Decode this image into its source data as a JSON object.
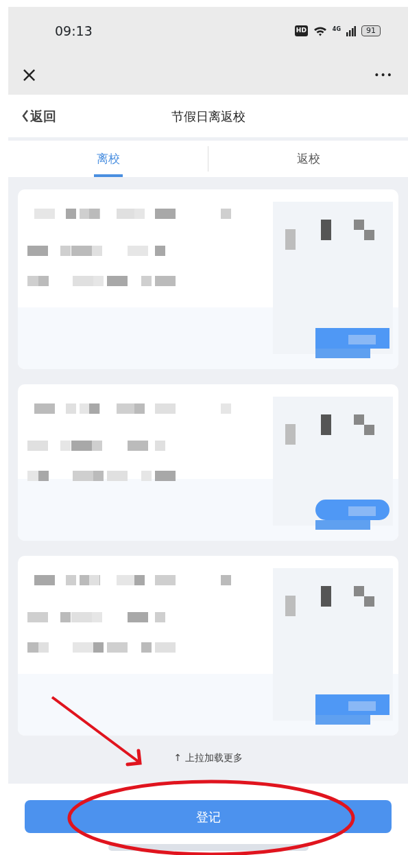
{
  "status_bar": {
    "time": "09:13",
    "badge": "HD",
    "network": "4G",
    "battery": "91"
  },
  "toolbar": {
    "close": "×",
    "more": "•••"
  },
  "header": {
    "back": "返回",
    "title": "节假日离返校"
  },
  "tabs": [
    {
      "label": "离校",
      "selected": true
    },
    {
      "label": "返校",
      "selected": false
    }
  ],
  "records": [
    {
      "kind": "redacted"
    },
    {
      "kind": "redacted"
    },
    {
      "kind": "redacted"
    }
  ],
  "load_more": "↑ 上拉加载更多",
  "register_button": "登记",
  "annotation_arrow": {
    "color": "#e0141e"
  },
  "annotation_ellipse": {
    "color": "#e0141e"
  }
}
